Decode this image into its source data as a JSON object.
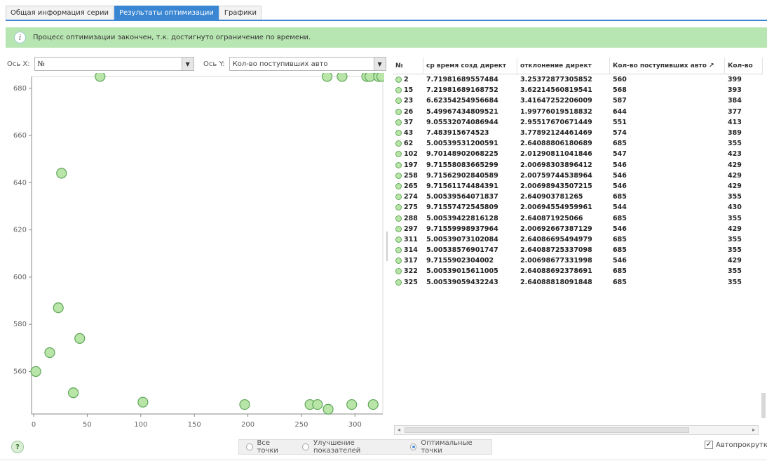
{
  "tabs": [
    {
      "label": "Общая информация серии",
      "active": false
    },
    {
      "label": "Результаты оптимизации",
      "active": true
    },
    {
      "label": "Графики",
      "active": false
    }
  ],
  "info": {
    "text": "Процесс оптимизации закончен, т.к. достигнуто ограничение по времени."
  },
  "axis_x": {
    "label": "Ось X:",
    "value": "№"
  },
  "axis_y": {
    "label": "Ось Y:",
    "value": "Кол-во поступивших авто"
  },
  "table": {
    "headers": [
      "№",
      "ср время созд директ",
      "отклонение директ",
      "Кол-во поступивших авто ↗",
      "Кол-во"
    ],
    "rows": [
      [
        "2",
        "7.71981689557484",
        "3.25372877305852",
        "560",
        "399"
      ],
      [
        "15",
        "7.21981689168752",
        "3.62214560819541",
        "568",
        "393"
      ],
      [
        "23",
        "6.62354254956684",
        "3.41647252206009",
        "587",
        "384"
      ],
      [
        "26",
        "5.49967434809521",
        "1.99776019518832",
        "644",
        "377"
      ],
      [
        "37",
        "9.05532074086944",
        "2.95517670671449",
        "551",
        "413"
      ],
      [
        "43",
        "7.483915674523",
        "3.77892124461469",
        "574",
        "389"
      ],
      [
        "62",
        "5.00539531200591",
        "2.64088806180689",
        "685",
        "355"
      ],
      [
        "102",
        "9.70148902068225",
        "2.01290811041846",
        "547",
        "423"
      ],
      [
        "197",
        "9.71558083665299",
        "2.00698303896412",
        "546",
        "429"
      ],
      [
        "258",
        "9.71562902840589",
        "2.00759744538964",
        "546",
        "429"
      ],
      [
        "265",
        "9.71561174484391",
        "2.00698943507215",
        "546",
        "429"
      ],
      [
        "274",
        "5.00539564071837",
        "2.640903781265",
        "685",
        "355"
      ],
      [
        "275",
        "9.71557472545809",
        "2.00694554959961",
        "544",
        "430"
      ],
      [
        "288",
        "5.00539422816128",
        "2.640871925066",
        "685",
        "355"
      ],
      [
        "297",
        "9.71559998937964",
        "2.00692667387129",
        "546",
        "429"
      ],
      [
        "311",
        "5.00539073102084",
        "2.64086695494979",
        "685",
        "355"
      ],
      [
        "314",
        "5.00538576901747",
        "2.64088725337098",
        "685",
        "355"
      ],
      [
        "317",
        "9.7155902304002",
        "2.00698677331998",
        "546",
        "429"
      ],
      [
        "322",
        "5.00539015611005",
        "2.64088692378691",
        "685",
        "355"
      ],
      [
        "325",
        "5.00539059432243",
        "2.64088818091848",
        "685",
        "355"
      ]
    ]
  },
  "chart_data": {
    "type": "scatter",
    "xlim": [
      -2,
      326
    ],
    "ylim": [
      542,
      685
    ],
    "x_ticks": [
      0,
      50,
      100,
      150,
      200,
      250,
      300
    ],
    "y_ticks": [
      560,
      580,
      600,
      620,
      640,
      660,
      680
    ],
    "points": [
      {
        "x": 2,
        "y": 560
      },
      {
        "x": 15,
        "y": 568
      },
      {
        "x": 23,
        "y": 587
      },
      {
        "x": 26,
        "y": 644
      },
      {
        "x": 37,
        "y": 551
      },
      {
        "x": 43,
        "y": 574
      },
      {
        "x": 62,
        "y": 685
      },
      {
        "x": 102,
        "y": 547
      },
      {
        "x": 197,
        "y": 546
      },
      {
        "x": 258,
        "y": 546
      },
      {
        "x": 265,
        "y": 546
      },
      {
        "x": 274,
        "y": 685
      },
      {
        "x": 275,
        "y": 544
      },
      {
        "x": 288,
        "y": 685
      },
      {
        "x": 297,
        "y": 546
      },
      {
        "x": 311,
        "y": 685
      },
      {
        "x": 314,
        "y": 685
      },
      {
        "x": 317,
        "y": 546
      },
      {
        "x": 322,
        "y": 685
      },
      {
        "x": 325,
        "y": 685
      }
    ],
    "point_fill": "#b9e6a8",
    "point_stroke": "#5fa65a"
  },
  "radios": [
    {
      "label": "Все точки",
      "selected": false
    },
    {
      "label": "Улучшение показателей",
      "selected": false
    },
    {
      "label": "Оптимальные точки",
      "selected": true
    }
  ],
  "autoscroll": {
    "label": "Автопрокрутка",
    "checked": true,
    "mark": "✓"
  },
  "help_label": "?",
  "colors": {
    "tab_active": "#3a86d3",
    "info_bg": "#b8e6b2"
  }
}
